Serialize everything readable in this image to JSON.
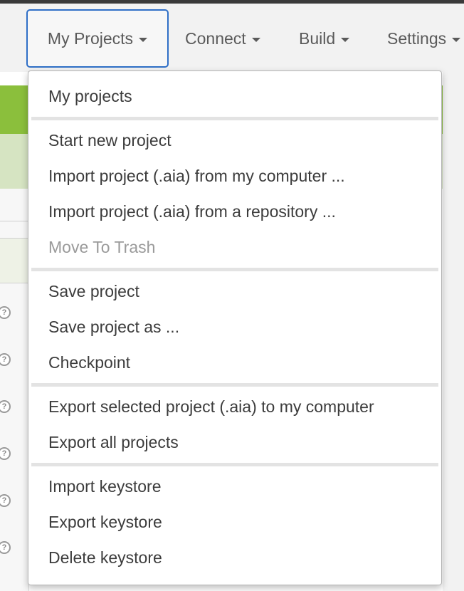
{
  "menubar": {
    "tabs": [
      {
        "label": "My Projects"
      },
      {
        "label": "Connect"
      },
      {
        "label": "Build"
      },
      {
        "label": "Settings"
      }
    ]
  },
  "dropdown": {
    "items": [
      {
        "label": "My projects"
      },
      {
        "label": "Start new project"
      },
      {
        "label": "Import project (.aia) from my computer ..."
      },
      {
        "label": "Import project (.aia) from a repository ..."
      },
      {
        "label": "Move To Trash",
        "disabled": true
      },
      {
        "label": "Save project"
      },
      {
        "label": "Save project as ..."
      },
      {
        "label": "Checkpoint"
      },
      {
        "label": "Export selected project (.aia) to my computer"
      },
      {
        "label": "Export all projects"
      },
      {
        "label": "Import keystore"
      },
      {
        "label": "Export keystore"
      },
      {
        "label": "Delete keystore"
      }
    ]
  },
  "help_icon_glyph": "?",
  "colors": {
    "accent_border": "#2f6fc7",
    "green_band": "#8bbf3c",
    "light_green_band": "#d6e4c2",
    "disabled_text": "#9a9a9a"
  }
}
